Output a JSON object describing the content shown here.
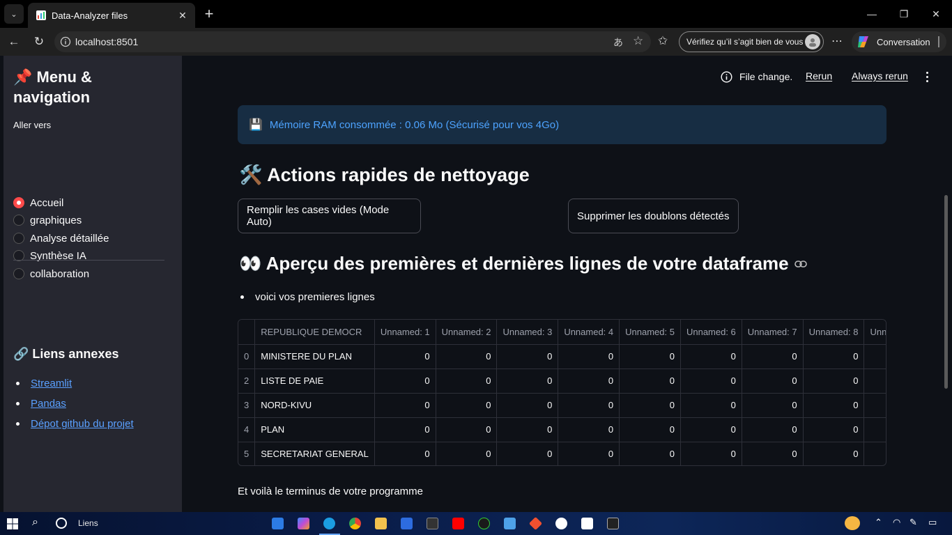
{
  "browser": {
    "tab_title": "Data-Analyzer files",
    "url": "localhost:8501",
    "verify_label": "Vérifiez qu’il s’agit bien de vous",
    "copilot_label": "Conversation"
  },
  "toolbar": {
    "file_change": "File change.",
    "rerun": "Rerun",
    "always_rerun": "Always rerun"
  },
  "sidebar": {
    "title": "📌 Menu & navigation",
    "goto_label": "Aller vers",
    "options": [
      "Accueil",
      "graphiques",
      "Analyse détaillée",
      "Synthèse IA",
      "collaboration"
    ],
    "selected": "Accueil",
    "links_title": "🔗 Liens annexes",
    "links": [
      "Streamlit",
      "Pandas",
      "Dépot github du projet"
    ]
  },
  "main": {
    "memory_info": "Mémoire RAM consommée : 0.06 Mo (Sécurisé pour vos 4Go)",
    "actions_heading": "🛠️ Actions rapides de nettoyage",
    "fill_button": "Remplir les cases vides (Mode Auto)",
    "dedupe_button": "Supprimer les doublons détectés",
    "preview_heading": "👀 Aperçu des premières et dernières lignes de votre dataframe",
    "preview_bullet": "voici vos premieres lignes",
    "table": {
      "columns": [
        "",
        "REPUBLIQUE DEMOCR",
        "Unnamed: 1",
        "Unnamed: 2",
        "Unnamed: 3",
        "Unnamed: 4",
        "Unnamed: 5",
        "Unnamed: 6",
        "Unnamed: 7",
        "Unnamed: 8",
        "Unn"
      ],
      "rows": [
        [
          "0",
          "MINISTERE DU PLAN",
          "0",
          "0",
          "0",
          "0",
          "0",
          "0",
          "0",
          "0",
          ""
        ],
        [
          "2",
          "LISTE DE PAIE",
          "0",
          "0",
          "0",
          "0",
          "0",
          "0",
          "0",
          "0",
          ""
        ],
        [
          "3",
          "NORD-KIVU",
          "0",
          "0",
          "0",
          "0",
          "0",
          "0",
          "0",
          "0",
          ""
        ],
        [
          "4",
          "PLAN",
          "0",
          "0",
          "0",
          "0",
          "0",
          "0",
          "0",
          "0",
          ""
        ],
        [
          "5",
          "SECRETARIAT GENERAL",
          "0",
          "0",
          "0",
          "0",
          "0",
          "0",
          "0",
          "0",
          ""
        ]
      ]
    },
    "footer": "Et voilà le terminus de votre programme"
  },
  "taskbar": {
    "search_label": "Liens"
  },
  "colors": {
    "accent_red": "#ff4b4b",
    "info_bg": "#172d43",
    "info_text": "#4da3ff",
    "link": "#5aa0ff"
  }
}
